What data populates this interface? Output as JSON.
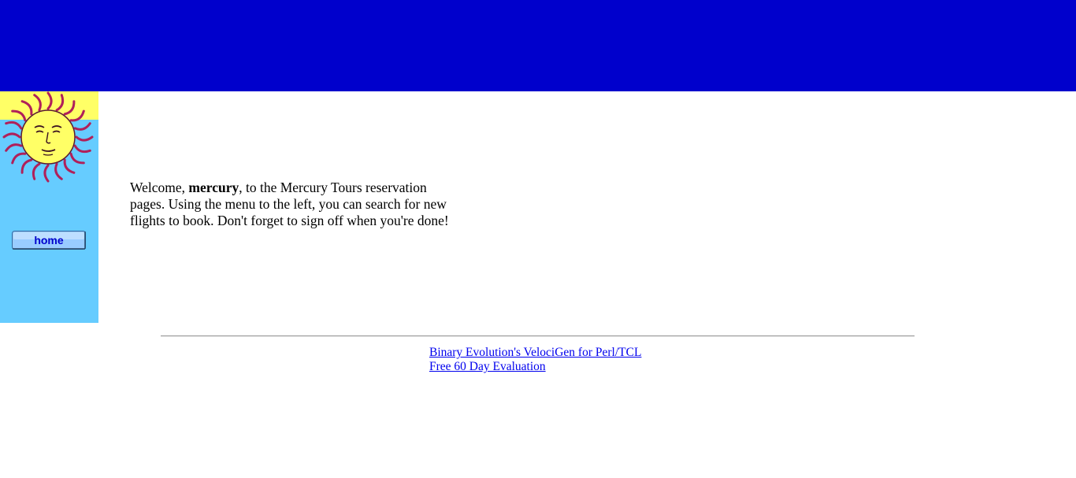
{
  "colors": {
    "banner": "#0000cc",
    "sidebar": "#66ccff",
    "sun_background": "#ffff66",
    "link": "#0000ee",
    "home_label": "#0000cc"
  },
  "sidebar": {
    "logo_icon": "sun-face-icon",
    "home_label": "home"
  },
  "welcome": {
    "prefix": "Welcome, ",
    "user": "mercury",
    "rest": ", to the Mercury Tours reservation pages. Using the menu to the left, you can search for new flights to book. Don't forget to sign off when you're done!"
  },
  "footer": {
    "link1": "Binary Evolution's VelociGen for Perl/TCL",
    "link2": "Free 60 Day Evaluation"
  }
}
